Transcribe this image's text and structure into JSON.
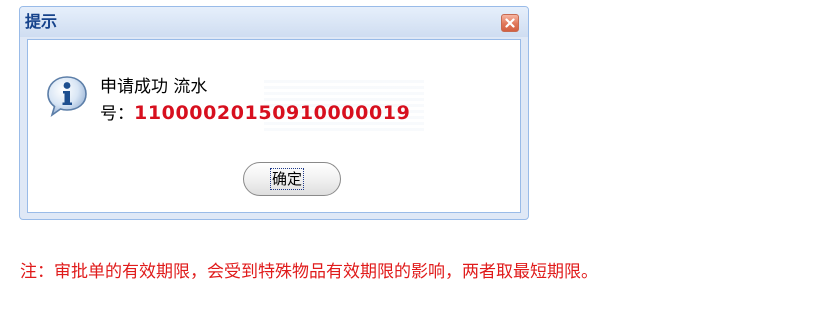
{
  "dialog": {
    "title": "提示",
    "message_line1": "申请成功 流水",
    "message_line2_prefix": "号：",
    "serial_number": "11000020150910000019",
    "ok_label": "确定",
    "icon": "info-icon",
    "close_icon": "close-icon"
  },
  "note": {
    "text": "注：审批单的有效期限，会受到特殊物品有效期限的影响，两者取最短期限。"
  },
  "colors": {
    "title_text": "#15428b",
    "serial": "#d70f1e",
    "note": "#e01b1b",
    "window_border": "#99bbe8",
    "close_button": "#e0775a"
  }
}
